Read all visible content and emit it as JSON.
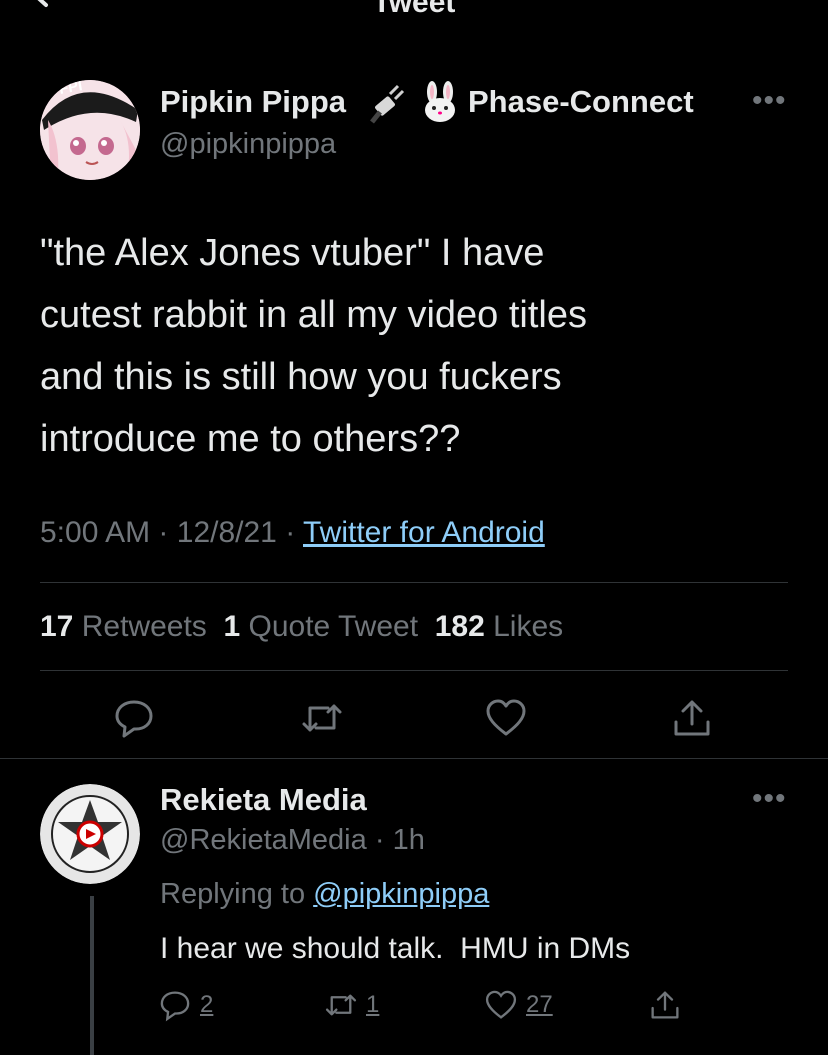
{
  "header": {
    "title": "Tweet"
  },
  "tweet": {
    "author_name": "Pipkin Pippa",
    "author_tags": "Phase-Connect",
    "handle": "@pipkinpippa",
    "text_lines": [
      "\"the Alex Jones vtuber\" I have",
      "cutest rabbit in all my video titles",
      "and this is still how you fuckers",
      "introduce me to others??"
    ],
    "time": "5:00 AM",
    "date": "12/8/21",
    "source": "Twitter for Android",
    "sep": "·",
    "stats": {
      "retweets_num": "17",
      "retweets_label": "Retweets",
      "quotes_num": "1",
      "quotes_label": "Quote Tweet",
      "likes_num": "182",
      "likes_label": "Likes"
    },
    "avatar_badge": "FPI"
  },
  "reply": {
    "author_name": "Rekieta Media",
    "handle": "@RekietaMedia",
    "age": "1h",
    "replying_prefix": "Replying to",
    "replying_to": "@pipkinpippa",
    "text": "I hear we should talk.  HMU in DMs",
    "counts": {
      "replies": "2",
      "retweets": "1",
      "likes": "27"
    }
  },
  "icons": {
    "back": "arrow-left-icon",
    "more": "more-horizontal-icon",
    "reply": "reply-bubble-icon",
    "retweet": "retweet-icon",
    "like": "heart-icon",
    "share": "share-icon"
  },
  "colors": {
    "background": "#000000",
    "link": "#8ecdf8",
    "muted": "#71767b",
    "text": "#e7e9ea",
    "divider": "#2f3336"
  }
}
